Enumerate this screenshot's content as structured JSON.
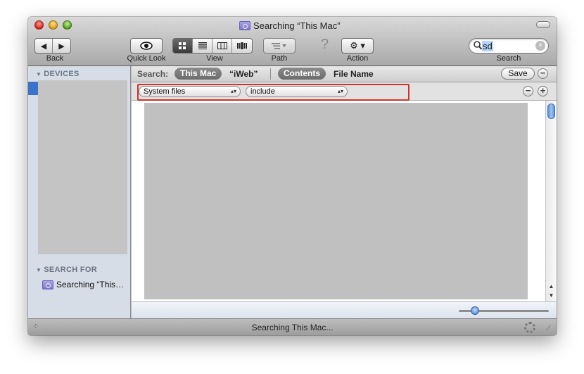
{
  "window": {
    "title": "Searching “This Mac”"
  },
  "toolbar": {
    "back_forward": {
      "back_glyph": "◀",
      "forward_glyph": "▶",
      "label": "Back"
    },
    "quick_look": {
      "glyph": "👁",
      "label": "Quick Look"
    },
    "view": {
      "label": "View",
      "modes": [
        "icon",
        "list",
        "column",
        "coverflow"
      ],
      "selected": "icon"
    },
    "path": {
      "label": "Path"
    },
    "help_glyph": "?",
    "action": {
      "glyph": "⚙ ▾",
      "label": "Action"
    },
    "search": {
      "value": "sd",
      "label": "Search",
      "clear_glyph": "×",
      "mag_glyph": "⚲"
    }
  },
  "sidebar": {
    "devices_header": "DEVICES",
    "search_for_header": "SEARCH FOR",
    "search_item_label": "Searching “This…"
  },
  "scope_bar": {
    "label": "Search:",
    "this_mac": "This Mac",
    "iweb": "“iWeb”",
    "contents": "Contents",
    "file_name": "File Name",
    "save_label": "Save",
    "minus": "−"
  },
  "criteria": {
    "attribute": "System files",
    "operator": "include",
    "minus": "−",
    "plus": "+"
  },
  "statusbar": {
    "status_text": "Searching This Mac..."
  },
  "zoom_slider": {
    "value_fraction": 0.15
  },
  "colors": {
    "highlight_box": "#d0332b",
    "sidebar_selection": "#3a73c9",
    "sidebar_bg": "#d7dde6"
  }
}
